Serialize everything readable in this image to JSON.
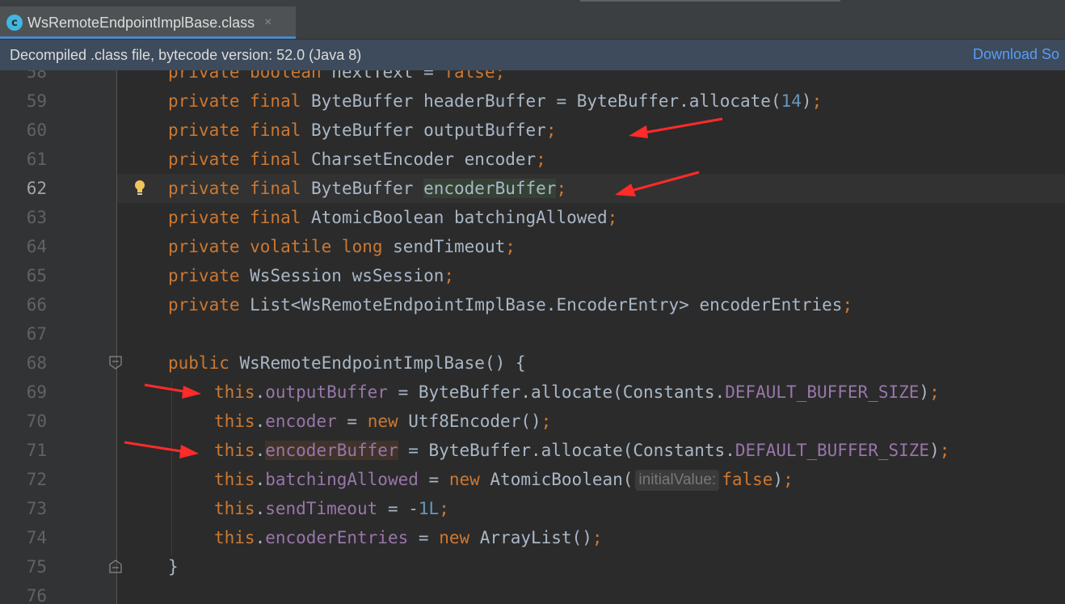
{
  "tab": {
    "title": "WsRemoteEndpointImplBase.class",
    "close_glyph": "×",
    "icon_letter": "c",
    "icon": "java-class-file-icon"
  },
  "banner": {
    "text": "Decompiled .class file, bytecode version: 52.0 (Java 8)",
    "link": "Download So"
  },
  "colors": {
    "keyword": "#cc7832",
    "field": "#9876aa",
    "number": "#6897bb",
    "plain": "#a9b7c6",
    "annotation_arrow": "#ff2a2a",
    "background": "#2b2b2b"
  },
  "editor": {
    "current_line": "62",
    "lines": [
      {
        "num": "58",
        "code": "private boolean nextText = false;"
      },
      {
        "num": "59",
        "code": "private final ByteBuffer headerBuffer = ByteBuffer.allocate(14);"
      },
      {
        "num": "60",
        "code": "private final ByteBuffer outputBuffer;"
      },
      {
        "num": "61",
        "code": "private final CharsetEncoder encoder;"
      },
      {
        "num": "62",
        "code": "private final ByteBuffer encoderBuffer;"
      },
      {
        "num": "63",
        "code": "private final AtomicBoolean batchingAllowed;"
      },
      {
        "num": "64",
        "code": "private volatile long sendTimeout;"
      },
      {
        "num": "65",
        "code": "private WsSession wsSession;"
      },
      {
        "num": "66",
        "code": "private List<WsRemoteEndpointImplBase.EncoderEntry> encoderEntries;"
      },
      {
        "num": "67",
        "code": ""
      },
      {
        "num": "68",
        "code": "public WsRemoteEndpointImplBase() {"
      },
      {
        "num": "69",
        "code": "this.outputBuffer = ByteBuffer.allocate(Constants.DEFAULT_BUFFER_SIZE);"
      },
      {
        "num": "70",
        "code": "this.encoder = new Utf8Encoder();"
      },
      {
        "num": "71",
        "code": "this.encoderBuffer = ByteBuffer.allocate(Constants.DEFAULT_BUFFER_SIZE);"
      },
      {
        "num": "72",
        "code": "this.batchingAllowed = new AtomicBoolean(false);",
        "param_hint": "initialValue:"
      },
      {
        "num": "73",
        "code": "this.sendTimeout = -1L;"
      },
      {
        "num": "74",
        "code": "this.encoderEntries = new ArrayList();"
      },
      {
        "num": "75",
        "code": "}"
      },
      {
        "num": "76",
        "code": ""
      }
    ]
  }
}
